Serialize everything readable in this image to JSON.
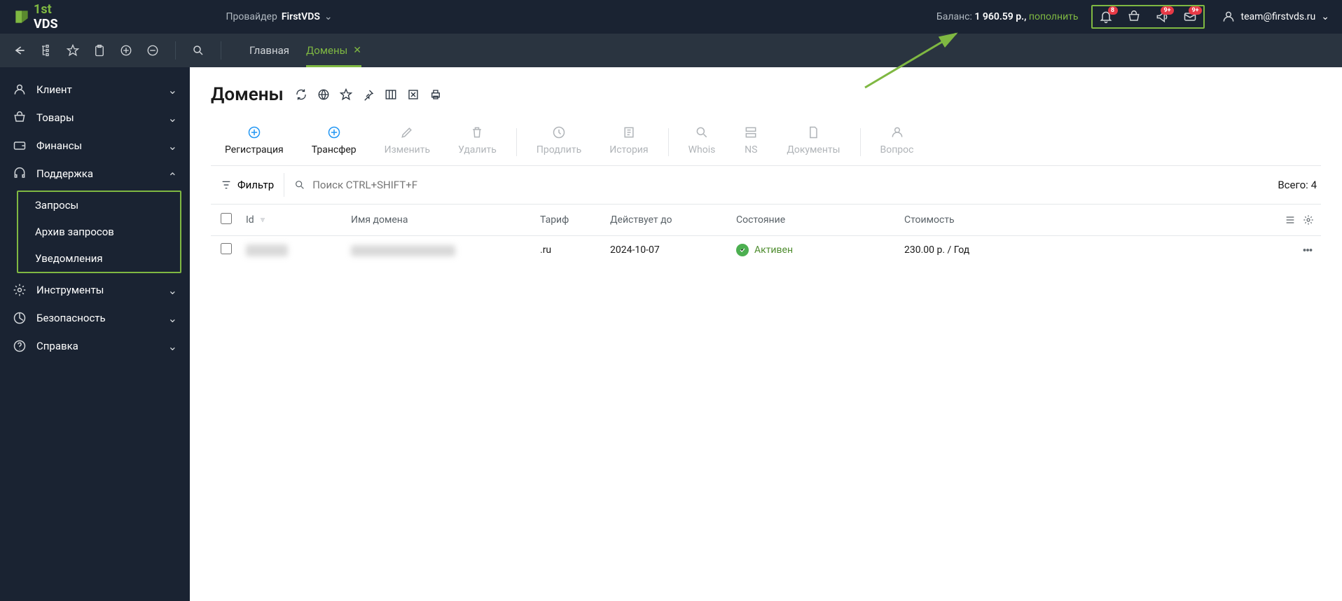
{
  "header": {
    "logo_text": "VDS",
    "provider_label": "Провайдер",
    "provider_name": "FirstVDS",
    "balance_label": "Баланс:",
    "balance_value": "1 960.59 р.,",
    "topup": "пополнить",
    "badge_bell": "8",
    "badge_speaker": "9+",
    "badge_mail": "9+",
    "user_email": "team@firstvds.ru"
  },
  "tabs": [
    {
      "label": "Главная",
      "active": false
    },
    {
      "label": "Домены",
      "active": true
    }
  ],
  "sidebar": {
    "items": [
      {
        "label": "Клиент",
        "expanded": false
      },
      {
        "label": "Товары",
        "expanded": false
      },
      {
        "label": "Финансы",
        "expanded": false
      },
      {
        "label": "Поддержка",
        "expanded": true,
        "children": [
          "Запросы",
          "Архив запросов",
          "Уведомления"
        ]
      },
      {
        "label": "Инструменты",
        "expanded": false
      },
      {
        "label": "Безопасность",
        "expanded": false
      },
      {
        "label": "Справка",
        "expanded": false
      }
    ]
  },
  "page": {
    "title": "Домены",
    "actions": [
      {
        "label": "Регистрация",
        "state": "primary"
      },
      {
        "label": "Трансфер",
        "state": "primary"
      },
      {
        "label": "Изменить",
        "state": "disabled"
      },
      {
        "label": "Удалить",
        "state": "disabled"
      },
      {
        "label": "Продлить",
        "state": "disabled"
      },
      {
        "label": "История",
        "state": "disabled"
      },
      {
        "label": "Whois",
        "state": "disabled"
      },
      {
        "label": "NS",
        "state": "disabled"
      },
      {
        "label": "Документы",
        "state": "disabled"
      },
      {
        "label": "Вопрос",
        "state": "disabled"
      }
    ],
    "filter_label": "Фильтр",
    "search_placeholder": "Поиск CTRL+SHIFT+F",
    "total_label": "Всего:",
    "total_count": "4",
    "columns": {
      "id": "Id",
      "domain": "Имя домена",
      "tariff": "Тариф",
      "expires": "Действует до",
      "status": "Состояние",
      "cost": "Стоимость"
    },
    "rows": [
      {
        "id": "██████",
        "domain": "███████████████",
        "tariff": ".ru",
        "expires": "2024-10-07",
        "status": "Активен",
        "cost": "230.00 р. / Год"
      }
    ]
  }
}
